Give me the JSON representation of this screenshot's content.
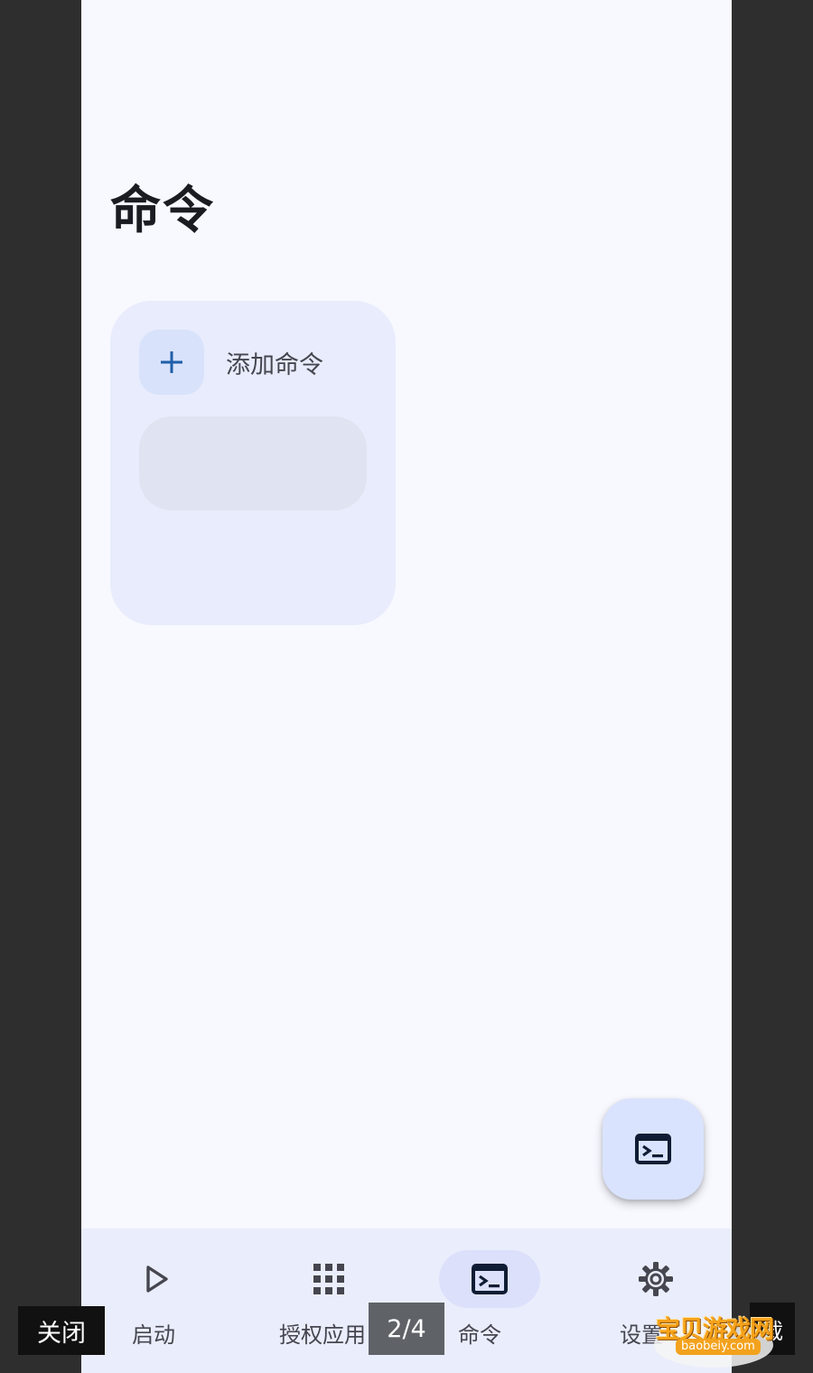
{
  "page": {
    "title": "命令"
  },
  "command_card": {
    "add_label": "添加命令",
    "add_icon": "plus-icon"
  },
  "fab": {
    "icon": "terminal-icon"
  },
  "bottom_nav": {
    "selected_index": 2,
    "items": [
      {
        "label": "启动",
        "icon": "play-icon"
      },
      {
        "label": "授权应用",
        "icon": "apps-grid-icon"
      },
      {
        "label": "命令",
        "icon": "terminal-icon"
      },
      {
        "label": "设置",
        "icon": "gear-icon"
      }
    ]
  },
  "viewer_overlay": {
    "close_label": "关闭",
    "counter": "2/4",
    "right_button_label": "载"
  },
  "watermark": {
    "text": "宝贝游戏网",
    "url": "baobeiy.com"
  },
  "colors": {
    "background": "#f8f8ff",
    "card": "#e8ecfc",
    "accent": "#d9e3fd",
    "nav_bar": "#eaedfb",
    "plus_icon": "#1f5fa8"
  }
}
